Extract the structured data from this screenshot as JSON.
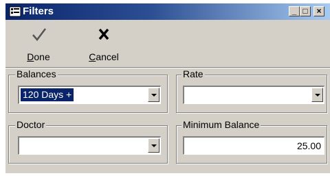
{
  "window": {
    "title": "Filters",
    "minimize_glyph": "_",
    "maximize_glyph": "□",
    "close_glyph": "×"
  },
  "toolbar": {
    "done": {
      "label_first": "D",
      "label_rest": "one",
      "icon": "checkmark-icon"
    },
    "cancel": {
      "label_first": "C",
      "label_rest": "ancel",
      "icon": "x-icon"
    }
  },
  "filters": {
    "balances": {
      "label": "Balances",
      "value": "120 Days +"
    },
    "rate": {
      "label": "Rate",
      "value": ""
    },
    "doctor": {
      "label": "Doctor",
      "value": ""
    },
    "minimum_balance": {
      "label": "Minimum Balance",
      "value": "25.00"
    }
  },
  "colors": {
    "titlebar_start": "#0a246a",
    "titlebar_end": "#a6caf0",
    "face": "#d4d0c8",
    "selection": "#0a246a"
  }
}
